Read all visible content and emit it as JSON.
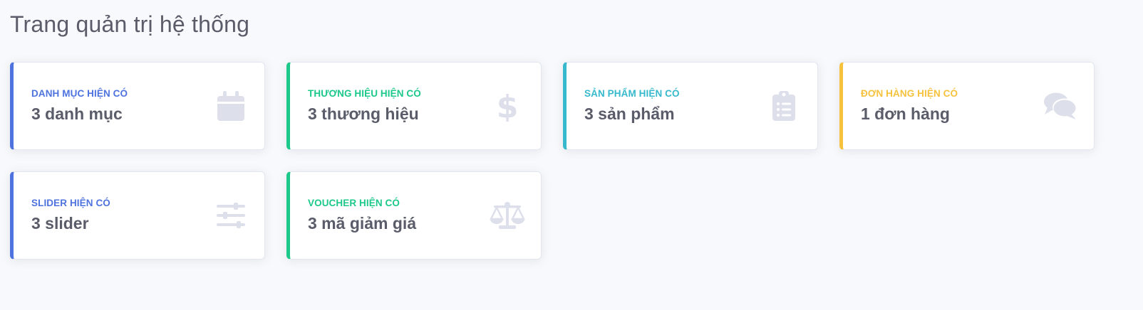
{
  "page": {
    "title": "Trang quản trị hệ thống"
  },
  "cards": [
    {
      "label": "DANH MỤC HIỆN CÓ",
      "value": "3 danh mục",
      "icon": "calendar-icon",
      "accent": "#4e73df"
    },
    {
      "label": "THƯƠNG HIỆU HIỆN CÓ",
      "value": "3 thương hiệu",
      "icon": "dollar-icon",
      "accent": "#1cc88a"
    },
    {
      "label": "SẢN PHẨM HIỆN CÓ",
      "value": "3 sản phẩm",
      "icon": "clipboard-list-icon",
      "accent": "#36b9cc"
    },
    {
      "label": "ĐƠN HÀNG HIỆN CÓ",
      "value": "1 đơn hàng",
      "icon": "comments-icon",
      "accent": "#f6c23e"
    },
    {
      "label": "SLIDER HIỆN CÓ",
      "value": "3 slider",
      "icon": "sliders-icon",
      "accent": "#4e73df"
    },
    {
      "label": "VOUCHER HIỆN CÓ",
      "value": "3 mã giảm giá",
      "icon": "balance-scale-icon",
      "accent": "#1cc88a"
    }
  ],
  "colors": {
    "background": "#f8f9fc",
    "text": "#5a5c69",
    "icon": "#dddfeb"
  }
}
